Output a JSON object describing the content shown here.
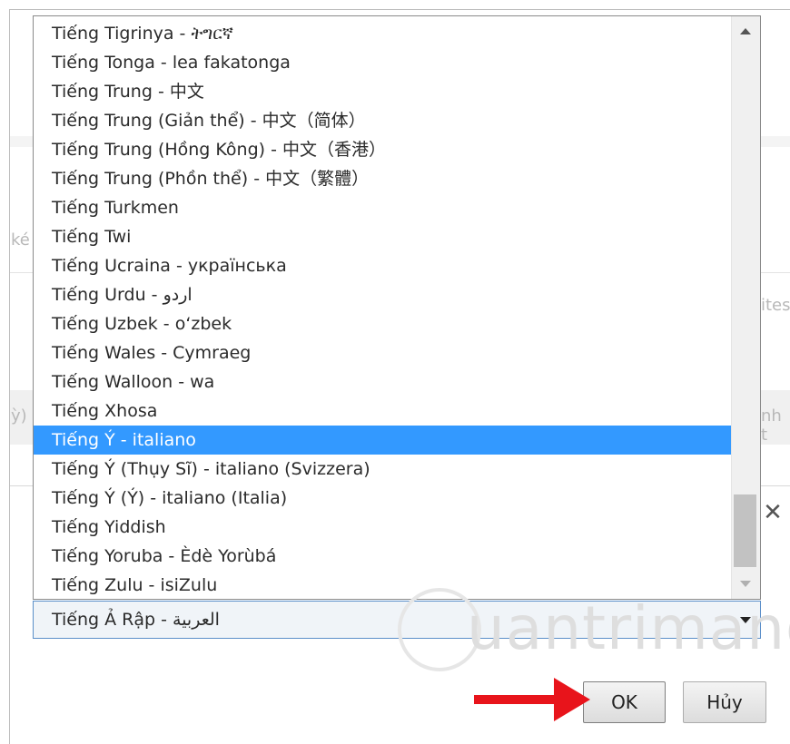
{
  "background": {
    "fragment_left_1": "ké",
    "fragment_left_2": "ỳ)",
    "fragment_right_1": "ites",
    "fragment_right_2": "nh t"
  },
  "language_list": {
    "items": [
      "Tiếng Tigrinya - ትግርኛ",
      "Tiếng Tonga - lea fakatonga",
      "Tiếng Trung - 中文",
      "Tiếng Trung (Giản thể) - 中文（简体）",
      "Tiếng Trung (Hồng Kông) - 中文（香港）",
      "Tiếng Trung (Phồn thể) - 中文（繁體）",
      "Tiếng Turkmen",
      "Tiếng Twi",
      "Tiếng Ucraina - українська",
      "Tiếng Urdu - اردو",
      "Tiếng Uzbek - o‘zbek",
      "Tiếng Wales - Cymraeg",
      "Tiếng Walloon - wa",
      "Tiếng Xhosa",
      "Tiếng Ý - italiano",
      "Tiếng Ý (Thụy Sĩ) - italiano (Svizzera)",
      "Tiếng Ý (Ý) - italiano (Italia)",
      "Tiếng Yiddish",
      "Tiếng Yoruba - Èdè Yorùbá",
      "Tiếng Zulu - isiZulu"
    ],
    "selected_index": 14
  },
  "language_select": {
    "value": "Tiếng Ả Rập - العربية"
  },
  "watermark": {
    "text": "uantrimang"
  },
  "buttons": {
    "ok_label": "OK",
    "cancel_label": "Hủy"
  },
  "colors": {
    "selection": "#3399ff",
    "annotation_arrow": "#e8141b"
  },
  "icons": {
    "close": "close-icon",
    "scroll_up": "chevron-up-icon",
    "scroll_down": "chevron-down-icon",
    "dropdown": "chevron-down-icon"
  }
}
